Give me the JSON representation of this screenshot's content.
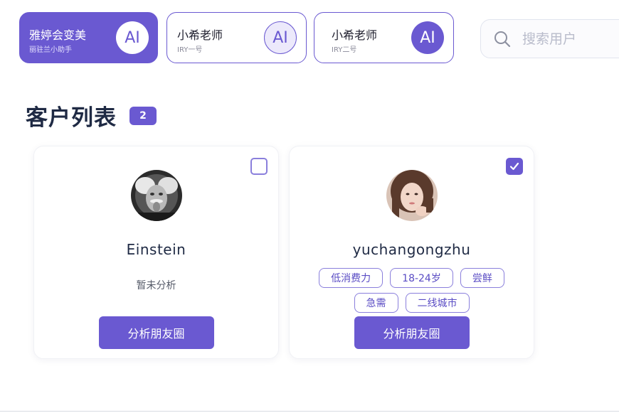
{
  "accounts": [
    {
      "name": "雅婷会变美",
      "sub": "丽驻兰小助手",
      "ai_label": "AI",
      "active": true
    },
    {
      "name": "小希老师",
      "sub": "IRY一号",
      "ai_label": "AI",
      "active": false
    },
    {
      "name": "小希老师",
      "sub": "IRY二号",
      "ai_label": "AI",
      "active": false
    }
  ],
  "search": {
    "placeholder": "搜索用户",
    "icon": "search-icon"
  },
  "customer_list": {
    "title": "客户列表",
    "count": "2",
    "customers": [
      {
        "name": "Einstein",
        "checked": false,
        "status": "暂未分析",
        "tags": [],
        "button_label": "分析朋友圈"
      },
      {
        "name": "yuchangongzhu",
        "checked": true,
        "status": "",
        "tags": [
          "低消费力",
          "18-24岁",
          "尝鲜",
          "急需",
          "二线城市"
        ],
        "button_label": "分析朋友圈"
      }
    ]
  },
  "colors": {
    "accent": "#6a59d1",
    "title": "#1f2a44",
    "border": "#e1e4ee"
  }
}
